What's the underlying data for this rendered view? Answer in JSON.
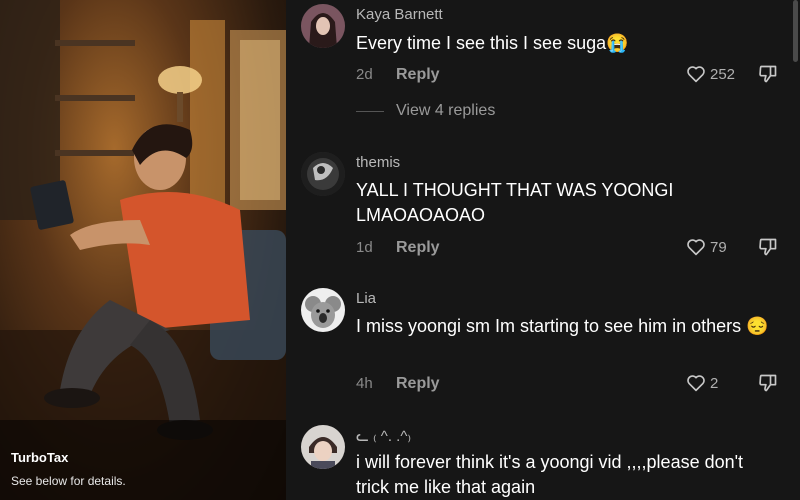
{
  "ad": {
    "brand": "TurboTax",
    "note": "See below for details."
  },
  "comments": [
    {
      "username": "Kaya Barnett",
      "text": "Every time I see this I see suga😭",
      "age": "2d",
      "reply_label": "Reply",
      "likes": "252"
    },
    {
      "username": "themis",
      "text": "YALL I THOUGHT THAT WAS YOONGI LMAOAOAOAO",
      "age": "1d",
      "reply_label": "Reply",
      "likes": "79"
    },
    {
      "username": "Lia",
      "text": "I miss yoongi sm Im starting to see him in others 😔",
      "age": "4h",
      "reply_label": "Reply",
      "likes": "2"
    },
    {
      "username": "ᓚ ₍ ^. .^₎",
      "text": "i will forever think it's a yoongi vid ,,,,please don't trick me like that again"
    }
  ],
  "view_replies_label": "View 4 replies",
  "icons": {
    "like": "heart-outline-icon",
    "dislike": "thumbs-down-icon"
  }
}
